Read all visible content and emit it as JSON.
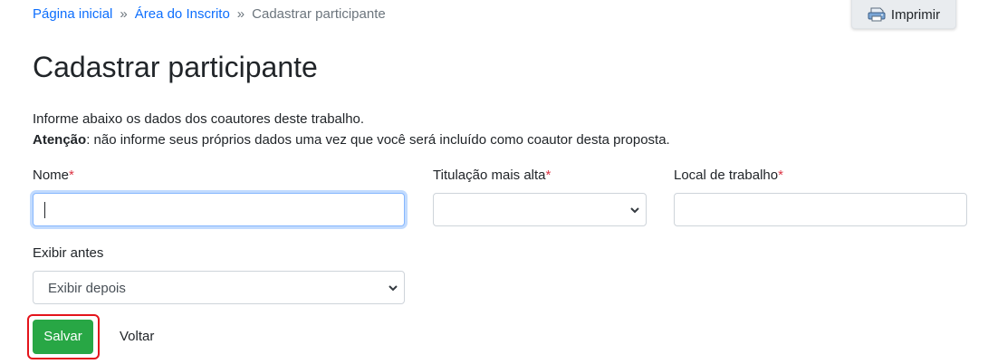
{
  "breadcrumb": {
    "home": "Página inicial",
    "area": "Área do Inscrito",
    "current": "Cadastrar participante",
    "separator": "»"
  },
  "toolbar": {
    "print_label": "Imprimir",
    "print_icon": "printer-icon"
  },
  "page": {
    "title": "Cadastrar participante",
    "info_line1": "Informe abaixo os dados dos coautores deste trabalho.",
    "attention_label": "Atenção",
    "attention_text": ": não informe seus próprios dados uma vez que você será incluído como coautor desta proposta."
  },
  "form": {
    "required_mark": "*",
    "nome_label": "Nome",
    "nome_value": "",
    "titulacao_label": "Titulação mais alta",
    "titulacao_value": "",
    "local_label": "Local de trabalho",
    "local_value": "",
    "exibir_label": "Exibir antes",
    "exibir_value": "Exibir depois"
  },
  "actions": {
    "save_label": "Salvar",
    "back_label": "Voltar"
  },
  "colors": {
    "link": "#0d6efd",
    "required": "#dc3545",
    "save": "#28a745",
    "highlight": "#e4141b"
  }
}
